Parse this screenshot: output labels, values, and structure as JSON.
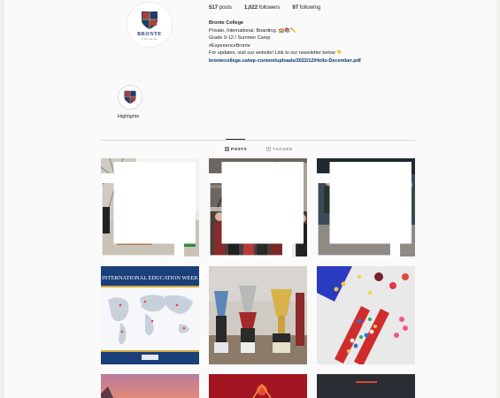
{
  "profile": {
    "brand_text": "BRONTE",
    "brand_sub": "COLLEGE",
    "stats": [
      {
        "count": "517",
        "label": "posts"
      },
      {
        "count": "1,022",
        "label": "followers"
      },
      {
        "count": "97",
        "label": "following"
      }
    ],
    "bio": {
      "name": "Bronte College",
      "line1": "Private. International. Boarding. 🏫📚✏️",
      "line2": "Grade 9-12 / Summer Camp",
      "line3": "#ExperienceBronte",
      "line4": "For updates, visit our website! Link to our newsletter below 👇",
      "link": "brontecollege.ca/wp-content/uploads/2022/12/Hello-December.pdf"
    }
  },
  "highlights": [
    {
      "label": "Highlights",
      "icon": "crest-icon"
    }
  ],
  "tabs": [
    {
      "label": "POSTS",
      "icon": "grid-icon",
      "active": true
    },
    {
      "label": "TAGGED",
      "icon": "tag-icon",
      "active": false
    }
  ],
  "posts": {
    "education_week_title": "INTERNATIONAL EDUCATION WEEK"
  },
  "colors": {
    "link": "#00376b",
    "divider": "#dbdbdb",
    "brand_blue": "#1f3b6e"
  }
}
